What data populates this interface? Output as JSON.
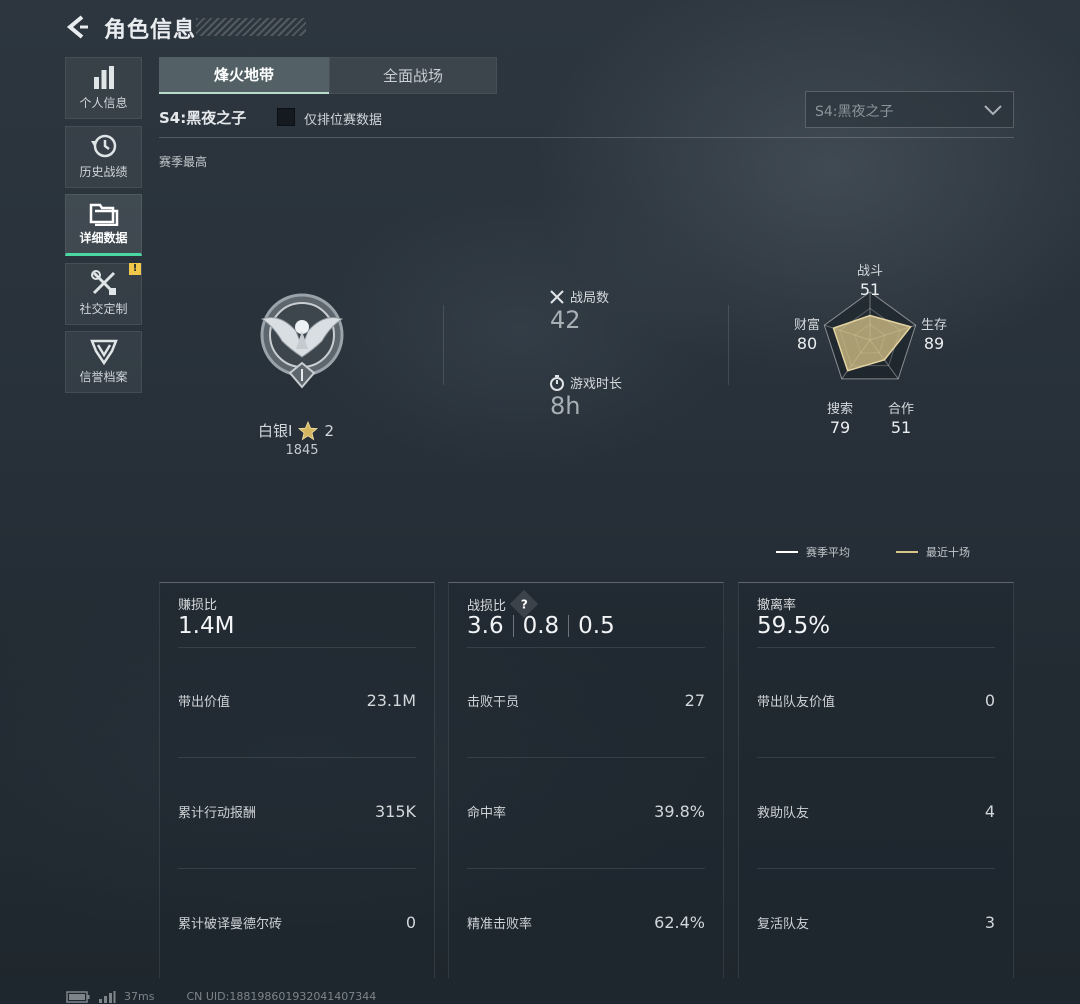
{
  "header": {
    "title": "角色信息"
  },
  "sidebar": {
    "items": [
      {
        "label": "个人信息",
        "icon": "bar-chart-icon"
      },
      {
        "label": "历史战绩",
        "icon": "history-icon"
      },
      {
        "label": "详细数据",
        "icon": "folder-icon",
        "active": true
      },
      {
        "label": "社交定制",
        "icon": "tools-icon",
        "alert": "!"
      },
      {
        "label": "信誉档案",
        "icon": "emblem-icon"
      }
    ]
  },
  "tabs": [
    {
      "label": "烽火地带",
      "active": true
    },
    {
      "label": "全面战场",
      "active": false
    }
  ],
  "filter": {
    "season_name": "S4:黑夜之子",
    "ranked_only_label": "仅排位赛数据",
    "ranked_only_checked": false,
    "season_select_value": "S4:黑夜之子"
  },
  "section_label": "赛季最高",
  "rank": {
    "name": "白银I",
    "stars": "2",
    "score": "1845"
  },
  "stats": {
    "matches_label": "战局数",
    "matches_value": "42",
    "playtime_label": "游戏时长",
    "playtime_value": "8h"
  },
  "radar": {
    "axes": [
      {
        "label": "战斗",
        "value": "51"
      },
      {
        "label": "生存",
        "value": "89"
      },
      {
        "label": "合作",
        "value": "51"
      },
      {
        "label": "搜索",
        "value": "79"
      },
      {
        "label": "财富",
        "value": "80"
      }
    ],
    "legend": [
      {
        "label": "赛季平均",
        "color": "#ffffff"
      },
      {
        "label": "最近十场",
        "color": "#d8c489"
      }
    ],
    "recent_color": "#d8c489"
  },
  "panels": {
    "profit": {
      "title": "赚损比",
      "value": "1.4M",
      "rows": [
        {
          "label": "带出价值",
          "value": "23.1M"
        },
        {
          "label": "累计行动报酬",
          "value": "315K"
        },
        {
          "label": "累计破译曼德尔砖",
          "value": "0"
        }
      ]
    },
    "kd": {
      "title": "战损比",
      "help": "?",
      "values": [
        "3.6",
        "0.8",
        "0.5"
      ],
      "rows": [
        {
          "label": "击败干员",
          "value": "27"
        },
        {
          "label": "命中率",
          "value": "39.8%"
        },
        {
          "label": "精准击败率",
          "value": "62.4%"
        }
      ]
    },
    "extract": {
      "title": "撤离率",
      "value": "59.5%",
      "rows": [
        {
          "label": "带出队友价值",
          "value": "0"
        },
        {
          "label": "救助队友",
          "value": "4"
        },
        {
          "label": "复活队友",
          "value": "3"
        }
      ]
    }
  },
  "footer": {
    "ping": "37ms",
    "uid": "CN UID:1881986019320414073​44"
  }
}
